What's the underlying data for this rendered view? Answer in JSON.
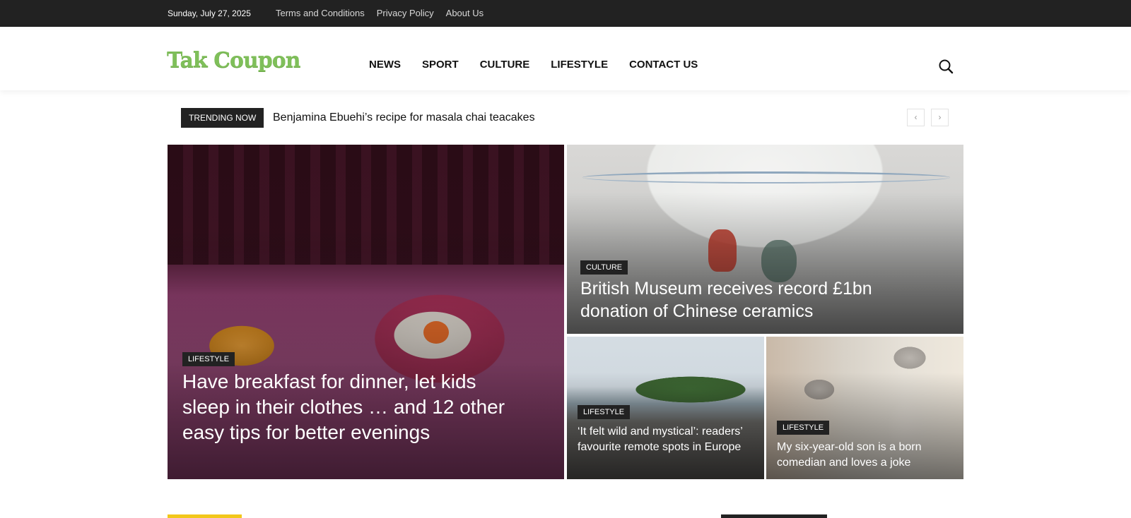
{
  "topbar": {
    "date": "Sunday, July 27, 2025",
    "links": [
      "Terms and Conditions",
      "Privacy Policy",
      "About Us"
    ]
  },
  "header": {
    "logo": "Tak Coupon",
    "nav": [
      "NEWS",
      "SPORT",
      "CULTURE",
      "LIFESTYLE",
      "CONTACT US"
    ],
    "search_icon": "search-icon"
  },
  "trending": {
    "label": "TRENDING NOW",
    "headline": "Benjamina Ebuehi’s recipe for masala chai teacakes",
    "prev": "‹",
    "next": "›"
  },
  "articles": [
    {
      "category": "LIFESTYLE",
      "title": "Have breakfast for dinner, let kids sleep in their clothes … and 12 other easy tips for better evenings"
    },
    {
      "category": "CULTURE",
      "title": "British Museum receives record £1bn donation of Chinese ceramics"
    },
    {
      "category": "LIFESTYLE",
      "title": "‘It felt wild and mystical’: readers’ favourite remote spots in Europe"
    },
    {
      "category": "LIFESTYLE",
      "title": "My six-year-old son is a born comedian and loves a joke"
    }
  ],
  "colors": {
    "topbar_bg": "#222222",
    "logo_green": "#7fbf5a",
    "section_accent": "#f2c71b"
  }
}
